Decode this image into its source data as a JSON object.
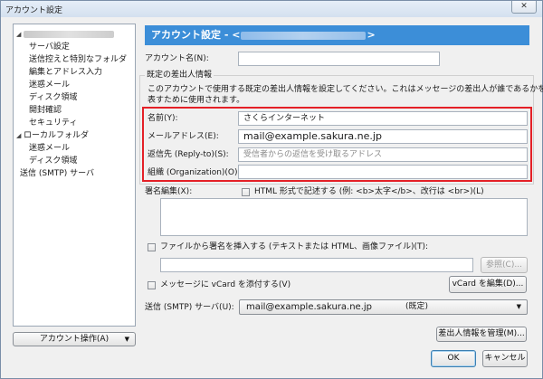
{
  "window": {
    "title": "アカウント設定",
    "close_label": "✕"
  },
  "sidebar": {
    "items": [
      {
        "label": "",
        "twisty": "◢"
      },
      {
        "label": "サーバ設定"
      },
      {
        "label": "送信控えと特別なフォルダ"
      },
      {
        "label": "編集とアドレス入力"
      },
      {
        "label": "迷惑メール"
      },
      {
        "label": "ディスク領域"
      },
      {
        "label": "開封確認"
      },
      {
        "label": "セキュリティ"
      },
      {
        "label": "ローカルフォルダ",
        "twisty": "◢"
      },
      {
        "label": "迷惑メール"
      },
      {
        "label": "ディスク領域"
      },
      {
        "label": "送信 (SMTP) サーバ"
      }
    ],
    "account_actions_label": "アカウント操作(A)"
  },
  "header": {
    "prefix": "アカウント設定 - <",
    "suffix": ">"
  },
  "account_name": {
    "label": "アカウント名(N):",
    "value": ""
  },
  "identity": {
    "group_title": "既定の差出人情報",
    "description_1": "このアカウントで使用する既定の差出人情報を設定してください。これはメッセージの差出人が誰であるかを",
    "description_2": "表すために使用されます。",
    "name_label": "名前(Y):",
    "name_value": "さくらインターネット",
    "email_label": "メールアドレス(E):",
    "email_value": "mail@example.sakura.ne.jp",
    "reply_to_label": "返信先 (Reply-to)(S):",
    "reply_to_placeholder": "受信者からの返信を受け取るアドレス",
    "org_label": "組織 (Organization)(O):",
    "org_value": ""
  },
  "signature": {
    "label": "署名編集(X):",
    "html_checkbox_label": "HTML 形式で記述する (例: <b>太字</b>、改行は <br>)(L)",
    "html_checked": false,
    "file_checkbox_label": "ファイルから署名を挿入する (テキストまたは HTML、画像ファイル)(T):",
    "file_checked": false,
    "file_path": "",
    "browse_label": "参照(C)..."
  },
  "vcard": {
    "checkbox_label": "メッセージに vCard を添付する(V)",
    "checked": false,
    "edit_label": "vCard を編集(D)..."
  },
  "smtp": {
    "label": "送信 (SMTP) サーバ(U):",
    "server": "mail@example.sakura.ne.jp",
    "suffix": "(既定)"
  },
  "buttons": {
    "manage_identities": "差出人情報を管理(M)...",
    "ok": "OK",
    "cancel": "キャンセル"
  },
  "colors": {
    "accent": "#3c8ed8",
    "highlight_border": "#e42027"
  }
}
